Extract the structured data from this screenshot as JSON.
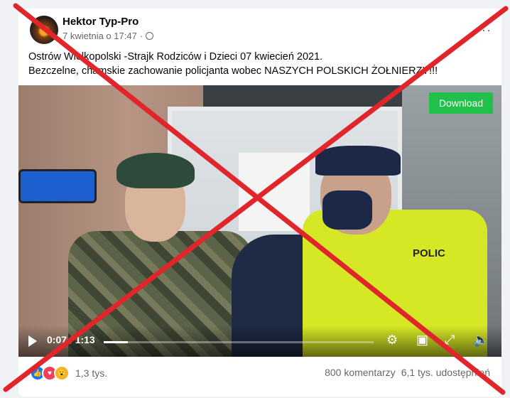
{
  "post": {
    "author": "Hektor Typ-Pro",
    "date": "7 kwietnia o 17:47",
    "more_icon": "···",
    "text_line1": "Ostrów Wielkopolski -Strajk Rodziców i Dzieci 07 kwiecień 2021.",
    "text_line2": "Bezczelne, chamskie zachowanie policjanta wobec NASZYCH POLSKICH ŻOŁNIERZY!!!"
  },
  "video": {
    "download_label": "Download",
    "vest_text": "POLIC",
    "time": "0:07 / 1:13",
    "progress": 0.09,
    "icons": [
      "play-icon",
      "settings-icon",
      "pip-icon",
      "fullscreen-icon",
      "volume-icon"
    ]
  },
  "footer": {
    "reactions_count": "1,3 tys.",
    "comments": "800 komentarzy",
    "shares": "6,1 tys. udostępnień"
  },
  "overlay": {
    "cross_color": "#e0252b"
  }
}
